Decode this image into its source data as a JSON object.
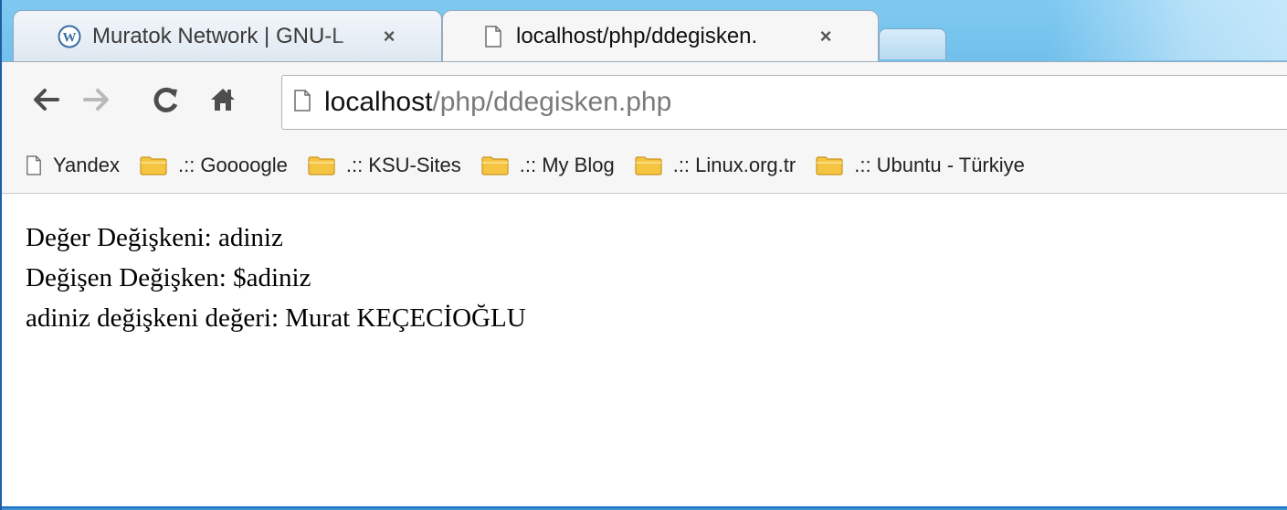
{
  "tabs": [
    {
      "title": "Muratok Network | GNU-L",
      "close": "×",
      "icon": "wordpress-icon",
      "active": false
    },
    {
      "title": "localhost/php/ddegisken.",
      "close": "×",
      "icon": "page-icon",
      "active": true
    }
  ],
  "toolbar": {
    "back": "←",
    "forward": "→",
    "reload": "C",
    "home": "home-icon",
    "url_host": "localhost",
    "url_path": "/php/ddegisken.php"
  },
  "bookmarks": [
    {
      "label": "Yandex",
      "icon": "page-icon"
    },
    {
      "label": ".:: Goooogle",
      "icon": "folder-icon"
    },
    {
      "label": ".:: KSU-Sites",
      "icon": "folder-icon"
    },
    {
      "label": ".:: My Blog",
      "icon": "folder-icon"
    },
    {
      "label": ".:: Linux.org.tr",
      "icon": "folder-icon"
    },
    {
      "label": ".:: Ubuntu - Türkiye",
      "icon": "folder-icon"
    }
  ],
  "content": {
    "lines": [
      "Değer Değişkeni: adiniz",
      "Değişen Değişken: $adiniz",
      "adiniz değişkeni değeri: Murat KEÇECİOĞLU"
    ]
  },
  "colors": {
    "frame": "#4aa3dc",
    "folder": "#f5c542",
    "toolbar": "#f6f6f6"
  }
}
